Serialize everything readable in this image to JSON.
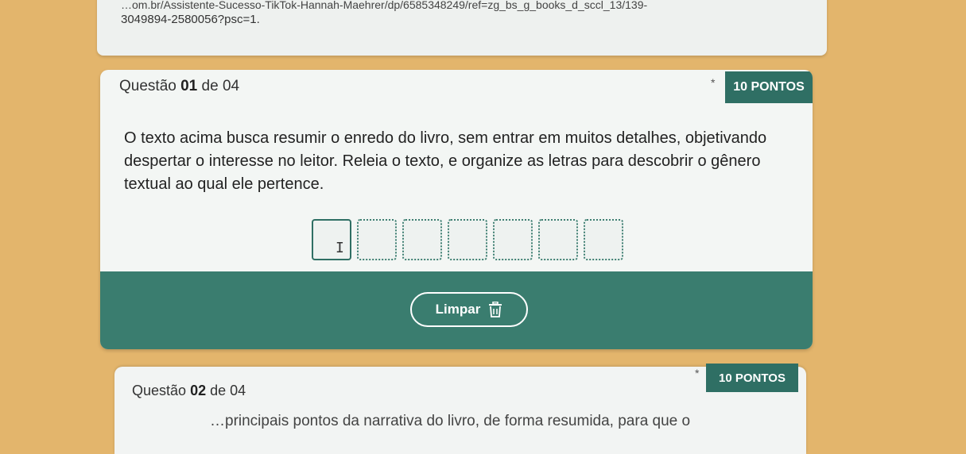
{
  "url": {
    "line1": "…om.br/Assistente-Sucesso-TikTok-Hannah-Maehrer/dp/6585348249/ref=zg_bs_g_books_d_sccl_13/139-",
    "line2": "3049894-2580056?psc=1."
  },
  "question1": {
    "label": "Questão",
    "number": "01",
    "of": "de 04",
    "required_mark": "*",
    "points": "10 PONTOS",
    "text": "O texto acima busca resumir o enredo do livro, sem entrar em muitos detalhes, objetivando despertar o interesse no leitor. Releia o texto, e organize as letras para descobrir o gênero textual ao qual ele pertence.",
    "slots": 7,
    "clear_label": "Limpar",
    "clear_icon": "trash-icon"
  },
  "question2": {
    "label": "Questão",
    "number": "02",
    "of": "de 04",
    "required_mark": "*",
    "points": "10 PONTOS",
    "text": "…principais pontos da narrativa do livro, de forma resumida, para que o"
  }
}
